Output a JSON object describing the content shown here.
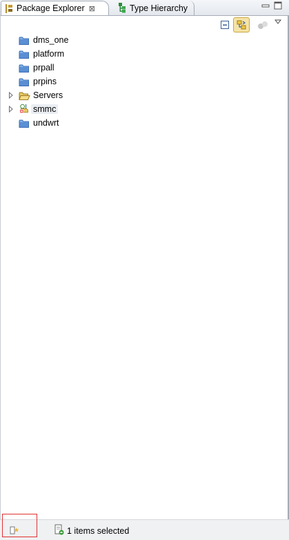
{
  "tabs": {
    "package_explorer": {
      "label": "Package Explorer",
      "close": "⊠"
    },
    "type_hierarchy": {
      "label": "Type Hierarchy"
    }
  },
  "view_controls": {
    "minimize": "minimize",
    "maximize": "maximize"
  },
  "toolbar": {
    "collapse_all": "collapse-all",
    "link_with_editor": "link-with-editor",
    "view_menu": "view-menu"
  },
  "tree": {
    "items": [
      {
        "label": "dms_one",
        "type": "folder",
        "expandable": false
      },
      {
        "label": "platform",
        "type": "folder",
        "expandable": false
      },
      {
        "label": "prpall",
        "type": "folder",
        "expandable": false
      },
      {
        "label": "prpins",
        "type": "folder",
        "expandable": false
      },
      {
        "label": "Servers",
        "type": "open-folder",
        "expandable": true
      },
      {
        "label": "smmc",
        "type": "java-project-error",
        "expandable": true,
        "selected": true
      },
      {
        "label": "undwrt",
        "type": "folder",
        "expandable": false
      }
    ]
  },
  "status": {
    "text": "1 items selected"
  },
  "colors": {
    "folder": "#5b8fd4",
    "selection": "#eaeef3",
    "highlight_box": "#e03030"
  }
}
